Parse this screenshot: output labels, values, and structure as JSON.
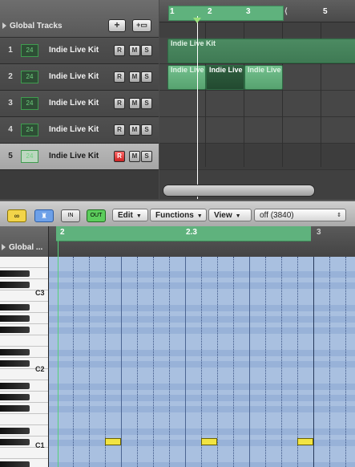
{
  "arrange": {
    "global_tracks_label": "Global Tracks",
    "add_track_btn": "+",
    "add_folder_btn": "+▭",
    "ruler": [
      "1",
      "2",
      "3",
      "4",
      "5"
    ],
    "tracks": [
      {
        "num": "1",
        "icon_text": "24",
        "name": "Indie Live Kit",
        "r": "R",
        "m": "M",
        "s": "S"
      },
      {
        "num": "2",
        "icon_text": "24",
        "name": "Indie Live Kit",
        "r": "R",
        "m": "M",
        "s": "S"
      },
      {
        "num": "3",
        "icon_text": "24",
        "name": "Indie Live Kit",
        "r": "R",
        "m": "M",
        "s": "S"
      },
      {
        "num": "4",
        "icon_text": "24",
        "name": "Indie Live Kit",
        "r": "R",
        "m": "M",
        "s": "S"
      },
      {
        "num": "5",
        "icon_text": "24",
        "name": "Indie Live Kit",
        "r": "R",
        "m": "M",
        "s": "S"
      }
    ],
    "regions": {
      "track1": "Indie Live Kit",
      "track2_a": "Indie Live",
      "track2_b": "Indie Live",
      "track2_c": "Indie Live"
    }
  },
  "toolbar": {
    "link_icon": "link-icon",
    "catch_icon": "catch-icon",
    "midi_in_icon": "IN",
    "midi_out_icon": "OUT",
    "edit_menu": "Edit",
    "functions_menu": "Functions",
    "view_menu": "View",
    "quantize_value": "off (3840)"
  },
  "piano_roll": {
    "global_label": "Global ...",
    "ruler": [
      "2",
      "2.3",
      "3"
    ],
    "key_labels": [
      "C3",
      "C2",
      "C1"
    ]
  },
  "colors": {
    "cycle_green": "#5fb27d",
    "region_green": "#6cb887",
    "note_yellow": "#f2e442",
    "grid_blue": "#a9c0e0"
  }
}
